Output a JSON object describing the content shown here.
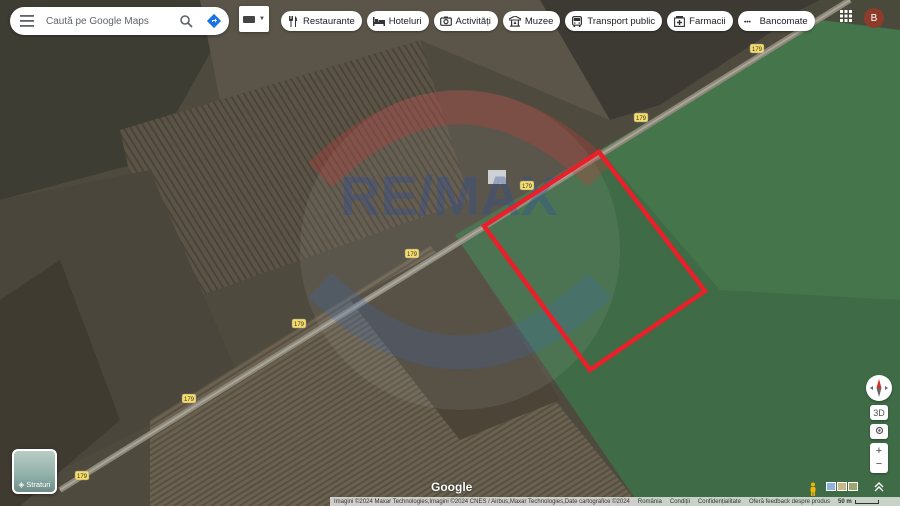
{
  "search": {
    "placeholder": "Caută pe Google Maps"
  },
  "chips": [
    {
      "label": "Restaurante",
      "icon": "fork-knife-icon"
    },
    {
      "label": "Hoteluri",
      "icon": "bed-icon"
    },
    {
      "label": "Activități",
      "icon": "camera-icon"
    },
    {
      "label": "Muzee",
      "icon": "museum-icon"
    },
    {
      "label": "Transport public",
      "icon": "bus-icon"
    },
    {
      "label": "Farmacii",
      "icon": "pharmacy-icon"
    },
    {
      "label": "Bancomate",
      "icon": "atm-icon"
    }
  ],
  "account": {
    "initial": "B"
  },
  "road": {
    "label": "179"
  },
  "watermark": {
    "text": "RE/MAX"
  },
  "layers": {
    "label": "Straturi"
  },
  "controls": {
    "three_d": "3D",
    "zoom_in": "+",
    "zoom_out": "−"
  },
  "brand": {
    "text": "Google"
  },
  "footer": {
    "attribution": "Imagini ©2024 Maxar Technologies,Imagini ©2024 CNES / Airbus,Maxar Technologies,Date cartografice ©2024",
    "country": "România",
    "terms": "Condiții",
    "privacy": "Confidențialitate",
    "feedback": "Oferă feedback despre produs",
    "scale": "50 m"
  },
  "colors": {
    "parcel_outline": "#e8202a",
    "accent_blue": "#1a73e8"
  }
}
